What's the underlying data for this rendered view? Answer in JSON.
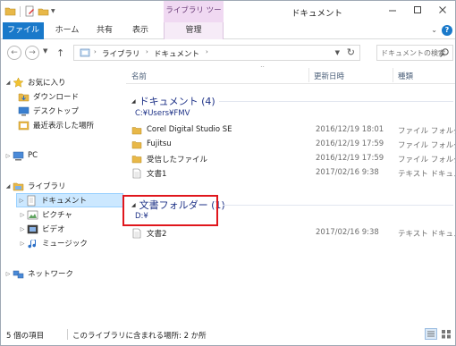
{
  "window": {
    "title": "ドキュメント",
    "context_tab_group": "ライブラリ ツール"
  },
  "ribbon": {
    "tabs": [
      {
        "label": "ファイル"
      },
      {
        "label": "ホーム"
      },
      {
        "label": "共有"
      },
      {
        "label": "表示"
      },
      {
        "label": "管理"
      }
    ]
  },
  "address": {
    "crumbs": [
      "ライブラリ",
      "ドキュメント"
    ]
  },
  "search": {
    "placeholder": "ドキュメントの検索"
  },
  "nav": {
    "items": [
      {
        "label": "お気に入り",
        "icon": "star-icon"
      },
      {
        "label": "ダウンロード",
        "icon": "download-folder-icon"
      },
      {
        "label": "デスクトップ",
        "icon": "desktop-icon"
      },
      {
        "label": "最近表示した場所",
        "icon": "recent-places-icon"
      },
      {
        "label": "PC",
        "icon": "computer-icon"
      },
      {
        "label": "ライブラリ",
        "icon": "library-icon"
      },
      {
        "label": "ドキュメント",
        "icon": "documents-library-icon"
      },
      {
        "label": "ピクチャ",
        "icon": "pictures-library-icon"
      },
      {
        "label": "ビデオ",
        "icon": "videos-library-icon"
      },
      {
        "label": "ミュージック",
        "icon": "music-library-icon"
      },
      {
        "label": "ネットワーク",
        "icon": "network-icon"
      }
    ]
  },
  "columns": {
    "name": "名前",
    "date": "更新日時",
    "type": "種類"
  },
  "groups": [
    {
      "title": "ドキュメント (4)",
      "path": "C:¥Users¥FMV",
      "rows": [
        {
          "name": "Corel Digital Studio SE",
          "date": "2016/12/19 18:01",
          "type": "ファイル フォルダー",
          "icon": "folder-icon"
        },
        {
          "name": "Fujitsu",
          "date": "2016/12/19 17:59",
          "type": "ファイル フォルダー",
          "icon": "folder-icon"
        },
        {
          "name": "受信したファイル",
          "date": "2016/12/19 17:59",
          "type": "ファイル フォルダー",
          "icon": "folder-icon"
        },
        {
          "name": "文書1",
          "date": "2017/02/16 9:38",
          "type": "テキスト ドキュメ",
          "icon": "text-file-icon"
        }
      ]
    },
    {
      "title": "文書フォルダー (1)",
      "path": "D:¥",
      "rows": [
        {
          "name": "文書2",
          "date": "2017/02/16 9:38",
          "type": "テキスト ドキュメ",
          "icon": "text-file-icon"
        }
      ]
    }
  ],
  "status": {
    "item_count": "5 個の項目",
    "library_info": "このライブラリに含まれる場所: 2 か所"
  },
  "colors": {
    "file_tab": "#1979ca",
    "context_tab": "#f0d9f2",
    "group_title": "#1e3287",
    "selection": "#cce8ff",
    "highlight_box": "#e0161c"
  }
}
